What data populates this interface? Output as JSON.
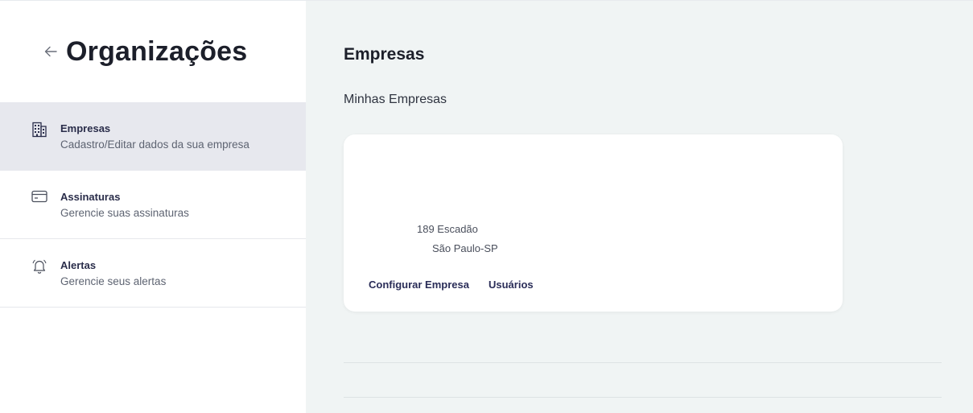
{
  "sidebar": {
    "back_icon": "arrow-left-icon",
    "title": "Organizações",
    "items": [
      {
        "icon": "building-icon",
        "title": "Empresas",
        "description": "Cadastro/Editar dados da sua empresa",
        "active": true
      },
      {
        "icon": "credit-card-icon",
        "title": "Assinaturas",
        "description": "Gerencie suas assinaturas",
        "active": false
      },
      {
        "icon": "bell-icon",
        "title": "Alertas",
        "description": "Gerencie seus alertas",
        "active": false
      }
    ]
  },
  "main": {
    "title": "Empresas",
    "subtitle": "Minhas Empresas",
    "company_card": {
      "address_line1": "189 Escadão",
      "address_line2": "São Paulo-SP",
      "actions": {
        "configure_label": "Configurar Empresa",
        "users_label": "Usuários"
      }
    }
  },
  "colors": {
    "sidebar_active_bg": "#e7e8ee",
    "main_bg": "#f0f4f4",
    "link": "#2a2d58",
    "title": "#1c1f2a"
  }
}
